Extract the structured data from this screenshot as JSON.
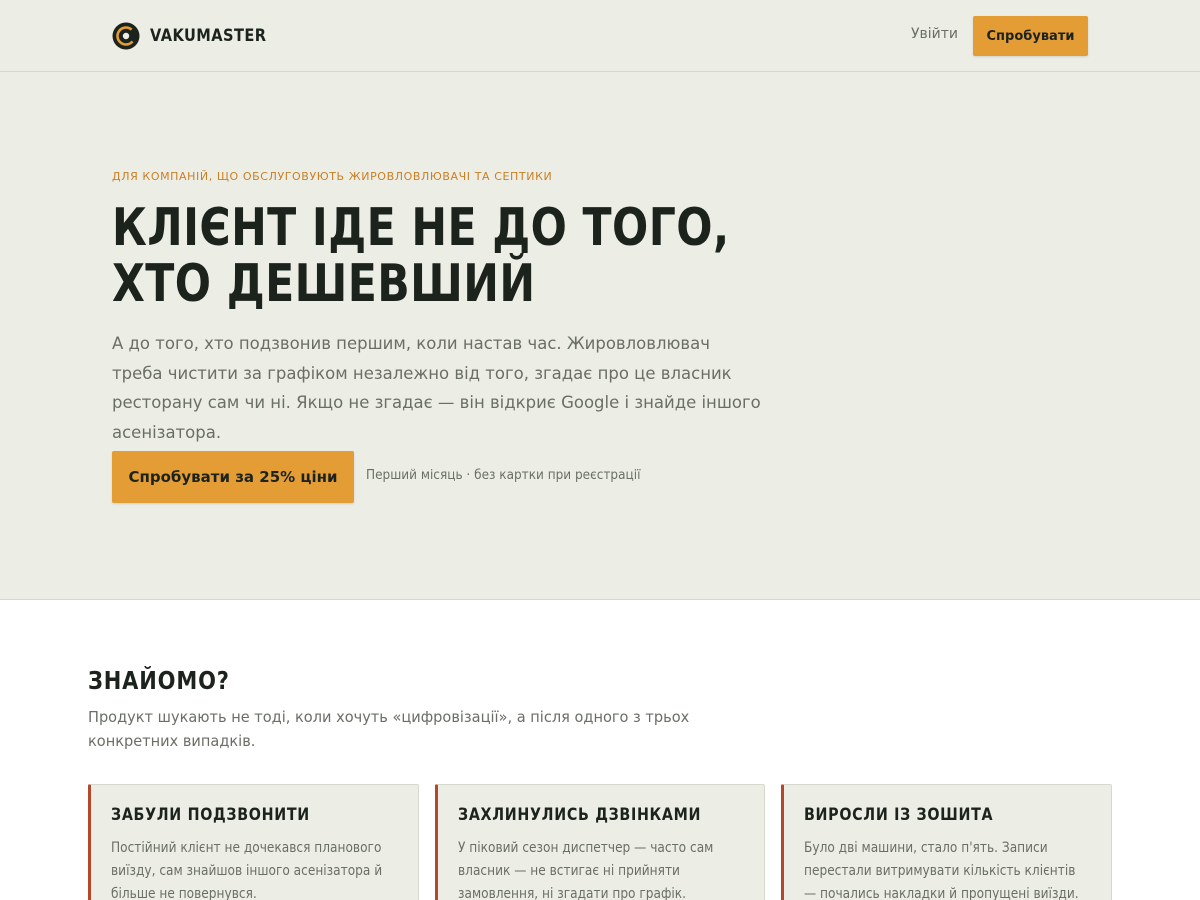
{
  "header": {
    "brand_name": "VAKUMASTER",
    "login_label": "Увійти",
    "cta_label": "Спробувати"
  },
  "hero": {
    "eyebrow": "ДЛЯ КОМПАНІЙ, ЩО ОБСЛУГОВУЮТЬ ЖИРОВЛОВЛЮВАЧІ ТА СЕПТИКИ",
    "title": "КЛІЄНТ ІДЕ НЕ ДО ТОГО, ХТО ДЕШЕВШИЙ",
    "lead": "А до того, хто подзвонив першим, коли настав час. Жировловлювач треба чистити за графіком незалежно від того, згадає про це власник ресторану сам чи ні. Якщо не згадає — він відкриє Google і знайде іншого асенізатора.",
    "cta_label": "Спробувати за 25% ціни",
    "note": "Перший місяць · без картки при реєстрації"
  },
  "problems": {
    "title": "ЗНАЙОМО?",
    "lead": "Продукт шукають не тоді, коли хочуть «цифровізації», а після одного з трьох конкретних випадків.",
    "cards": [
      {
        "title": "ЗАБУЛИ ПОДЗВОНИТИ",
        "text": "Постійний клієнт не дочекався планового виїзду, сам знайшов іншого асенізатора й більше не повернувся."
      },
      {
        "title": "ЗАХЛИНУЛИСЬ ДЗВІНКАМИ",
        "text": "У піковий сезон диспетчер — часто сам власник — не встигає ні прийняти замовлення, ні згадати про графік."
      },
      {
        "title": "ВИРОСЛИ ІЗ ЗОШИТА",
        "text": "Було дві машини, стало п'ять. Записи перестали витримувати кількість клієнтів — почались накладки й пропущені виїзди."
      }
    ]
  },
  "colors": {
    "background": "#eceee6",
    "accent": "#e49c35",
    "eyebrow": "#c97f24",
    "card_border_accent": "#b5482b",
    "text": "#1c231d",
    "muted": "#6a6f66"
  },
  "icons": {
    "brand_logo": "circular-c-logo-icon"
  }
}
